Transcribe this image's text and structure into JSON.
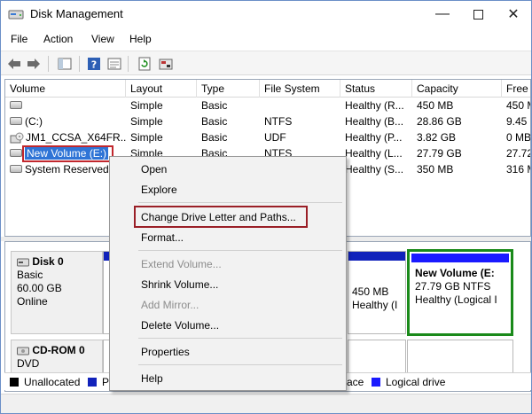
{
  "window": {
    "title": "Disk Management"
  },
  "menubar": {
    "items": [
      "File",
      "Action",
      "View",
      "Help"
    ]
  },
  "volumes": {
    "headers": [
      "Volume",
      "Layout",
      "Type",
      "File System",
      "Status",
      "Capacity",
      "Free"
    ],
    "rows": [
      {
        "volume": "",
        "layout": "Simple",
        "type": "Basic",
        "fs": "",
        "status": "Healthy (R...",
        "capacity": "450 MB",
        "free": "450 MB"
      },
      {
        "volume": "(C:)",
        "layout": "Simple",
        "type": "Basic",
        "fs": "NTFS",
        "status": "Healthy (B...",
        "capacity": "28.86 GB",
        "free": "9.45 ("
      },
      {
        "volume": "JM1_CCSA_X64FR...",
        "layout": "Simple",
        "type": "Basic",
        "fs": "UDF",
        "status": "Healthy (P...",
        "capacity": "3.82 GB",
        "free": "0 MB"
      },
      {
        "volume": "New Volume (E:)",
        "layout": "Simple",
        "type": "Basic",
        "fs": "NTFS",
        "status": "Healthy (L...",
        "capacity": "27.79 GB",
        "free": "27.72"
      },
      {
        "volume": "System Reserved",
        "layout": "",
        "type": "",
        "fs": "",
        "status": "Healthy (S...",
        "capacity": "350 MB",
        "free": "316 M"
      }
    ]
  },
  "disks": {
    "disk0": {
      "name": "Disk 0",
      "type": "Basic",
      "size": "60.00 GB",
      "state": "Online"
    },
    "disk0_part_mid": {
      "size": "450 MB",
      "status": "Healthy (I"
    },
    "disk0_part_new": {
      "name": "New Volume (E:",
      "size": "27.79 GB NTFS",
      "status": "Healthy (Logical I"
    },
    "cdrom0": {
      "name": "CD-ROM 0",
      "type": "DVD"
    }
  },
  "legend": {
    "unallocated": "Unallocated",
    "p_cut": "P",
    "free_cut": "ace",
    "logical": "Logical drive"
  },
  "context_menu": {
    "open": "Open",
    "explore": "Explore",
    "change_letter": "Change Drive Letter and Paths...",
    "format": "Format...",
    "extend": "Extend Volume...",
    "shrink": "Shrink Volume...",
    "add_mirror": "Add Mirror...",
    "delete": "Delete Volume...",
    "properties": "Properties",
    "help": "Help"
  },
  "colors": {
    "primary_partition": "#1122bb",
    "logical_drive": "#1a1aff",
    "unallocated": "#000000",
    "highlight_red": "#c1272d",
    "selected_green": "#1a8a1a"
  }
}
